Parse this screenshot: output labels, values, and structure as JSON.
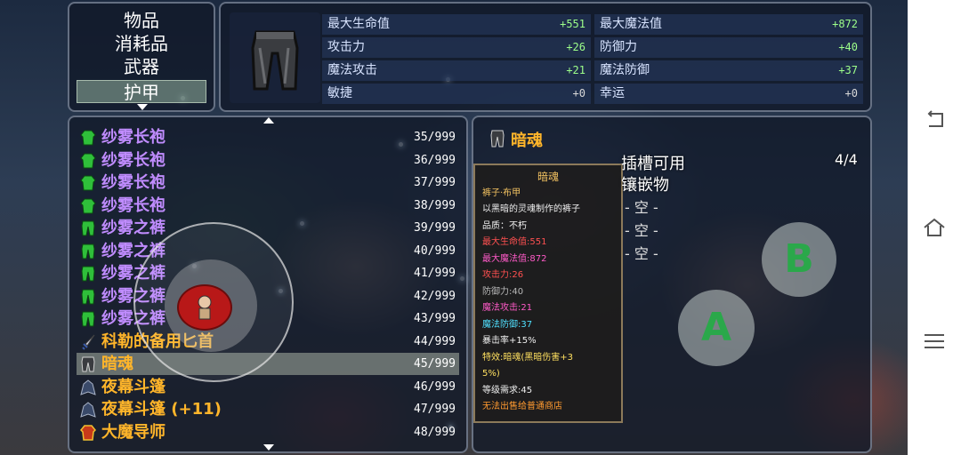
{
  "categories": {
    "items": [
      {
        "label": "物品"
      },
      {
        "label": "消耗品"
      },
      {
        "label": "武器"
      },
      {
        "label": "护甲",
        "selected": true
      }
    ]
  },
  "stats": {
    "cells": [
      {
        "label": "最大生命值",
        "value": "+551",
        "color": "pos"
      },
      {
        "label": "最大魔法值",
        "value": "+872",
        "color": "pos"
      },
      {
        "label": "攻击力",
        "value": "+26",
        "color": "pos"
      },
      {
        "label": "防御力",
        "value": "+40",
        "color": "pos"
      },
      {
        "label": "魔法攻击",
        "value": "+21",
        "color": "pos"
      },
      {
        "label": "魔法防御",
        "value": "+37",
        "color": "pos"
      },
      {
        "label": "敏捷",
        "value": "+0",
        "color": "zero"
      },
      {
        "label": "幸运",
        "value": "+0",
        "color": "zero"
      }
    ]
  },
  "inventory": {
    "items": [
      {
        "name": "纱雾长袍",
        "qty": "35/999",
        "color": "c-purple",
        "icon": "robe-icon"
      },
      {
        "name": "纱雾长袍",
        "qty": "36/999",
        "color": "c-purple",
        "icon": "robe-icon"
      },
      {
        "name": "纱雾长袍",
        "qty": "37/999",
        "color": "c-purple",
        "icon": "robe-icon"
      },
      {
        "name": "纱雾长袍",
        "qty": "38/999",
        "color": "c-purple",
        "icon": "robe-icon"
      },
      {
        "name": "纱雾之裤",
        "qty": "39/999",
        "color": "c-purple",
        "icon": "pants-icon"
      },
      {
        "name": "纱雾之裤",
        "qty": "40/999",
        "color": "c-purple",
        "icon": "pants-icon"
      },
      {
        "name": "纱雾之裤",
        "qty": "41/999",
        "color": "c-purple",
        "icon": "pants-icon"
      },
      {
        "name": "纱雾之裤",
        "qty": "42/999",
        "color": "c-purple",
        "icon": "pants-icon"
      },
      {
        "name": "纱雾之裤",
        "qty": "43/999",
        "color": "c-purple",
        "icon": "pants-icon"
      },
      {
        "name": "科勒的备用匕首",
        "qty": "44/999",
        "color": "c-orange",
        "icon": "dagger-icon"
      },
      {
        "name": "暗魂",
        "qty": "45/999",
        "color": "c-orange",
        "icon": "dark-pants-icon",
        "selected": true
      },
      {
        "name": "夜幕斗篷",
        "qty": "46/999",
        "color": "c-orange",
        "icon": "cloak-icon"
      },
      {
        "name": "夜幕斗篷 (+11)",
        "qty": "47/999",
        "color": "c-orange",
        "icon": "cloak-icon"
      },
      {
        "name": "大魔导师",
        "qty": "48/999",
        "color": "c-orange",
        "icon": "mage-robe-icon"
      }
    ]
  },
  "detail": {
    "title": "暗魂",
    "tooltip": [
      {
        "text": "暗魂",
        "color": "t-gold",
        "center": true
      },
      {
        "text": "裤子·布甲",
        "color": "t-gold"
      },
      {
        "text": "以黑暗的灵魂制作的裤子",
        "color": "t-white"
      },
      {
        "text": "品质：不朽",
        "color": "t-white"
      },
      {
        "text": "最大生命值:551",
        "color": "t-red"
      },
      {
        "text": "最大魔法值:872",
        "color": "t-magenta"
      },
      {
        "text": "攻击力:26",
        "color": "t-red"
      },
      {
        "text": "防御力:40",
        "color": "t-grey"
      },
      {
        "text": "魔法攻击:21",
        "color": "t-magenta"
      },
      {
        "text": "魔法防御:37",
        "color": "t-cyan"
      },
      {
        "text": "暴击率+15%",
        "color": "t-white"
      },
      {
        "text": "特效:暗魂(黑暗伤害+3",
        "color": "t-yellow"
      },
      {
        "text": "5%)",
        "color": "t-yellow"
      },
      {
        "text": "等级需求:45",
        "color": "t-white"
      },
      {
        "text": "无法出售给普通商店",
        "color": "t-orange"
      }
    ],
    "slots_label": "插槽可用",
    "slots_count": "4/4",
    "gems_label": "镶嵌物",
    "empty_slots": [
      "- 空 -",
      "- 空 -",
      "- 空 -"
    ]
  },
  "controls": {
    "btn_a": "A",
    "btn_b": "B"
  }
}
